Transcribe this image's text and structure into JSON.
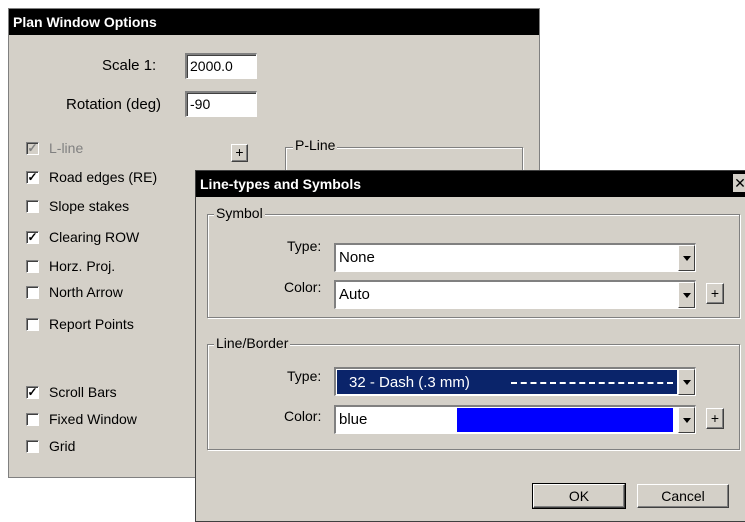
{
  "plan_window": {
    "title": "Plan Window Options",
    "scale_label": "Scale  1:",
    "scale_value": "2000.0",
    "rotation_label": "Rotation (deg)",
    "rotation_value": "-90",
    "plus_label": "+",
    "pline_group": "P-Line",
    "options": [
      {
        "label": "L-line",
        "checked": true,
        "disabled": true
      },
      {
        "label": "Road edges (RE)",
        "checked": true,
        "disabled": false
      },
      {
        "label": "Slope stakes",
        "checked": false,
        "disabled": false
      },
      {
        "label": "Clearing ROW",
        "checked": true,
        "disabled": false
      },
      {
        "label": "Horz. Proj.",
        "checked": false,
        "disabled": false
      },
      {
        "label": "North Arrow",
        "checked": false,
        "disabled": false
      },
      {
        "label": "Report Points",
        "checked": false,
        "disabled": false
      },
      {
        "label": "Scroll Bars",
        "checked": true,
        "disabled": false
      },
      {
        "label": "Fixed Window",
        "checked": false,
        "disabled": false
      },
      {
        "label": "Grid",
        "checked": false,
        "disabled": false
      }
    ]
  },
  "line_dialog": {
    "title": "Line-types and Symbols",
    "close_label": "✕",
    "symbol_group": "Symbol",
    "symbol_type_label": "Type:",
    "symbol_type_value": "None",
    "symbol_color_label": "Color:",
    "symbol_color_value": "Auto",
    "line_group": "Line/Border",
    "line_type_label": "Type:",
    "line_type_value": "32 - Dash (.3 mm)",
    "line_color_label": "Color:",
    "line_color_value": "blue",
    "plus_label": "+",
    "ok_label": "OK",
    "cancel_label": "Cancel",
    "colors": {
      "selection": "#0a246a",
      "swatch": "#0000ff"
    }
  }
}
